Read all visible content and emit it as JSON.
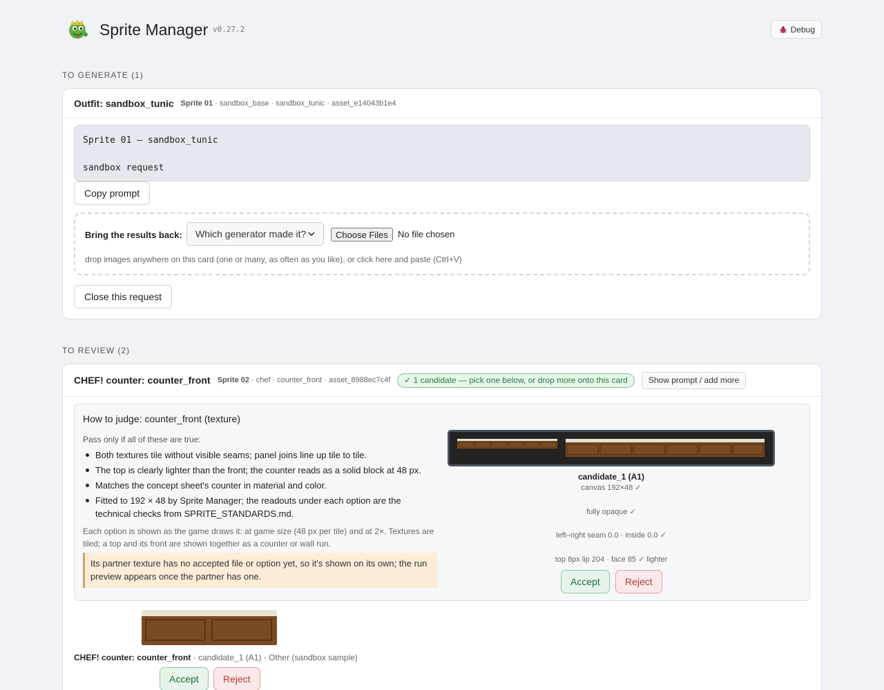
{
  "app": {
    "title": "Sprite Manager",
    "version": "v0.27.2",
    "debug_label": "Debug"
  },
  "to_generate": {
    "section_label": "TO GENERATE (1)",
    "card": {
      "title": "Outfit: sandbox_tunic",
      "sprite_label": "Sprite 01",
      "meta": " · sandbox_base · sandbox_tunic · asset_e14043b1e4",
      "prompt_text": "Sprite 01 — sandbox_tunic\n\nsandbox request",
      "copy_prompt_label": "Copy prompt",
      "bring_back_label": "Bring the results back:",
      "generator_select_value": "Which generator made it?",
      "choose_files_label": "Choose Files",
      "no_file_label": "No file chosen",
      "drop_hint": "drop images anywhere on this card (one or many, as often as you like), or click here and paste (Ctrl+V)",
      "close_request_label": "Close this request"
    }
  },
  "to_review": {
    "section_label": "TO REVIEW (2)",
    "card": {
      "title": "CHEF! counter: counter_front",
      "sprite_label": "Sprite 02",
      "meta": " · chef · counter_front · asset_8988ec7c4f",
      "candidate_pill": "✓ 1 candidate — pick one below, or drop more onto this card",
      "show_prompt_label": "Show prompt / add more",
      "judge": {
        "title": "How to judge: counter_front (texture)",
        "pass_only": "Pass only if all of these are true:",
        "criteria": [
          "Both textures tile without visible seams; panel joins line up tile to tile.",
          "The top is clearly lighter than the front; the counter reads as a solid block at 48 px.",
          "Matches the concept sheet's counter in material and color.",
          "Fitted to 192 × 48 by Sprite Manager; the readouts under each option are the technical checks from SPRITE_STANDARDS.md."
        ],
        "explain": "Each option is shown as the game draws it: at game size (48 px per tile) and at 2×. Textures are tiled; a top and its front are shown together as a counter or wall run.",
        "warning": "Its partner texture has no accepted file or option yet, so it's shown on its own; the run preview appears once the partner has one."
      },
      "candidate": {
        "name": "candidate_1 (A1)",
        "canvas": "canvas 192×48 ✓",
        "opaque": "fully opaque ✓",
        "seam": "left–right seam 0.0 · inside 0.0 ✓",
        "lip": "top 8px lip 204 · face 85 ✓ lighter",
        "accept_label": "Accept",
        "reject_label": "Reject"
      },
      "run_preview": {
        "title": "CHEF! counter: counter_front",
        "meta": " · candidate_1 (A1) · Other (sandbox sample)",
        "accept_label": "Accept",
        "reject_label": "Reject"
      }
    }
  },
  "colors": {
    "accept_green": "#1f6b37",
    "reject_red": "#b23b3b",
    "wood": "#7a4a22",
    "top_light": "#e8e2d4"
  }
}
